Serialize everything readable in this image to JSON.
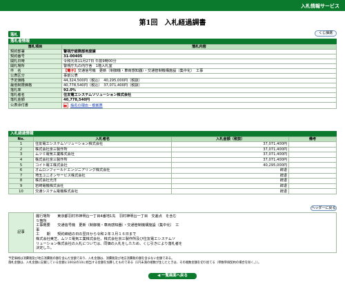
{
  "header": {
    "service_label": "入札情報サービス"
  },
  "title": "第1回　入札経過調書",
  "tab": {
    "label": "落札"
  },
  "buttons": {
    "back_top": "くじ抽選",
    "mid": "ヘッダーに戻る",
    "back_list": "◀ 一覧画面へ戻る"
  },
  "award": {
    "section_title": "落札者情報",
    "col_item": "落札項目",
    "col_content": "落札内容",
    "rows": [
      {
        "label": "契約部署",
        "value": "警視庁総務部用度課",
        "bold": true
      },
      {
        "label": "契約番号",
        "value": "31-00405",
        "bold": true
      },
      {
        "label": "開札日時",
        "value": "令和元年11月27日 午前9時00分",
        "bold": false
      },
      {
        "label": "開札場所",
        "value": "警視庁丸の内庁舎　1階入札室",
        "bold": false
      },
      {
        "label": "件　名",
        "value_prefix": "【電子】",
        "value": "交通信号機　更新（制御機・車両感知器）・交通管制機構施設（集中化）　工事",
        "bold": false
      },
      {
        "label": "公表区分",
        "value": "事前公表",
        "bold": false
      },
      {
        "label": "予定価格",
        "value": "44,324,500円（税込）　40,295,000円（税抜）",
        "bold": false
      },
      {
        "label": "最低制限価格",
        "value": "40,778,540円（税込）　37,071,400円（税抜）",
        "bold": false
      },
      {
        "label": "落札率",
        "value": "92.0%",
        "bold": true
      },
      {
        "label": "落札者名",
        "value": "住友電工システムソリューション株式会社",
        "bold": true
      },
      {
        "label": "落札金額",
        "value": "40,778,540円",
        "bold": true
      },
      {
        "label": "公表添付書",
        "value": "指名の理由・根拠票",
        "bold": false,
        "link": true
      }
    ]
  },
  "bids": {
    "section_title": "入札経過情報",
    "col_no": "No.",
    "col_name": "入札者名",
    "col_amount": "入札金額（税抜）",
    "col_remark": "備考",
    "rows": [
      {
        "no": "1",
        "name": "住友電工システムソリューション株式会社",
        "amount": "37,071,400円",
        "remark": ""
      },
      {
        "no": "2",
        "name": "株式会社京三製作所",
        "amount": "37,071,400円",
        "remark": ""
      },
      {
        "no": "3",
        "name": "ムツミ電気工業株式会社",
        "amount": "37,071,400円",
        "remark": ""
      },
      {
        "no": "4",
        "name": "株式会社京三製作所",
        "amount": "37,071,400円",
        "remark": ""
      },
      {
        "no": "5",
        "name": "コイト電工株式会社",
        "amount": "40,295,000円",
        "remark": ""
      },
      {
        "no": "6",
        "name": "オムロンフィールドエンジニアリング株式会社",
        "amount": "辞退",
        "remark": ""
      },
      {
        "no": "7",
        "name": "埼玉ユニオンサービス株式会社",
        "amount": "辞退",
        "remark": ""
      },
      {
        "no": "8",
        "name": "株式会社光洋",
        "amount": "辞退",
        "remark": ""
      },
      {
        "no": "9",
        "name": "岩崎電機株式会社",
        "amount": "辞退",
        "remark": ""
      },
      {
        "no": "10",
        "name": "交通システム電機株式会社",
        "amount": "辞退",
        "remark": ""
      }
    ]
  },
  "notes": {
    "label": "記事",
    "lines": [
      "履行場所　　東京都羽村市神明台一丁目4番地1先　羽村神明台一丁目　交差点　を含む",
      "５箇所",
      "工事概要　　交通信号機　更新（制御機・車両感知器）・交通管制機構施設（集中化）　工",
      "事",
      "工　　期　　契約締結の日の翌日から令和２年３月１６日まで",
      "株式会社東芝、ムツミ電気工業株式会社、株式会社京三製作所及び住友電工システムソ",
      "リューション株式会社の入札については、同価の入札をしたため、くじ引きにより落札者を",
      "決定した。"
    ]
  },
  "footnotes": [
    "予定価格は消費税及び地方消費税の額を含んだ金額であり、入札金額は、消費税及び地方消費税の額を含まない金額である。",
    "落札金額は、入札金額に記載している金額に100分の10に相当する金額を加算したものである（1円未満の端数が生じたときは、その端数金額を切り捨てる（単数単価契約の場合を除く。））。"
  ]
}
